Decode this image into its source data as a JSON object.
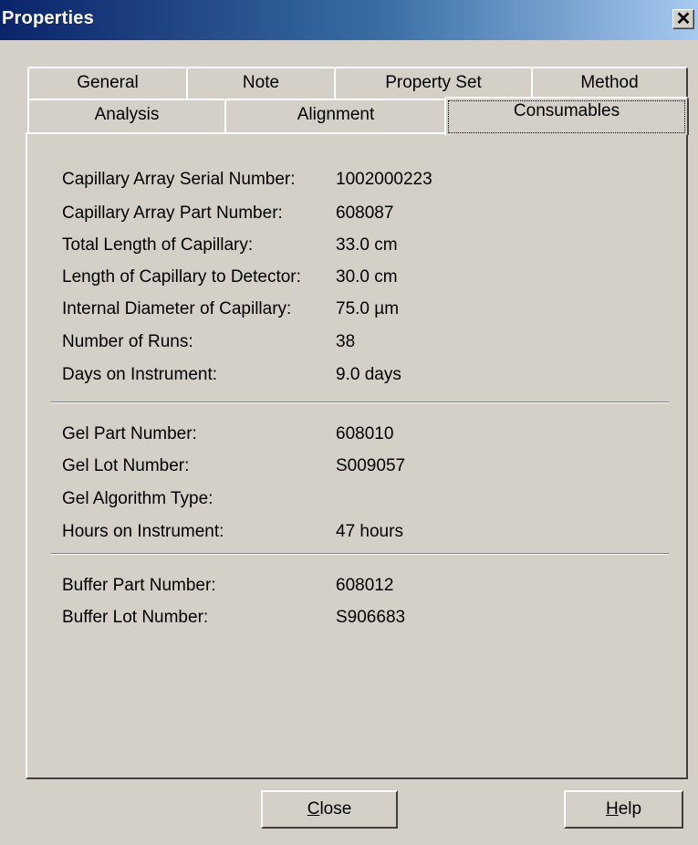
{
  "window": {
    "title": "Properties",
    "close_glyph": "✕"
  },
  "tabs": {
    "row1": [
      {
        "label": "General"
      },
      {
        "label": "Note"
      },
      {
        "label": "Property Set"
      },
      {
        "label": "Method"
      }
    ],
    "row2": [
      {
        "label": "Analysis"
      },
      {
        "label": "Alignment"
      },
      {
        "label": "Consumables",
        "selected": true
      }
    ]
  },
  "consumables": {
    "capillary": [
      {
        "label": "Capillary Array Serial Number:",
        "value": "1002000223"
      },
      {
        "label": "Capillary Array Part Number:",
        "value": "608087"
      },
      {
        "label": "Total Length of Capillary:",
        "value": "33.0 cm"
      },
      {
        "label": "Length of Capillary to Detector:",
        "value": "30.0 cm"
      },
      {
        "label": "Internal Diameter of Capillary:",
        "value": "75.0 µm"
      },
      {
        "label": "Number of Runs:",
        "value": "38"
      },
      {
        "label": "Days on Instrument:",
        "value": "9.0 days"
      }
    ],
    "gel": [
      {
        "label": "Gel Part Number:",
        "value": "608010"
      },
      {
        "label": "Gel Lot Number:",
        "value": "S009057"
      },
      {
        "label": "Gel Algorithm Type:",
        "value": ""
      },
      {
        "label": "Hours on Instrument:",
        "value": "47 hours"
      }
    ],
    "buffer": [
      {
        "label": "Buffer Part Number:",
        "value": "608012"
      },
      {
        "label": "Buffer Lot Number:",
        "value": "S906683"
      }
    ]
  },
  "buttons": {
    "close": {
      "prefix": "",
      "mnemonic": "C",
      "rest": "lose"
    },
    "help": {
      "prefix": "",
      "mnemonic": "H",
      "rest": "elp"
    }
  }
}
